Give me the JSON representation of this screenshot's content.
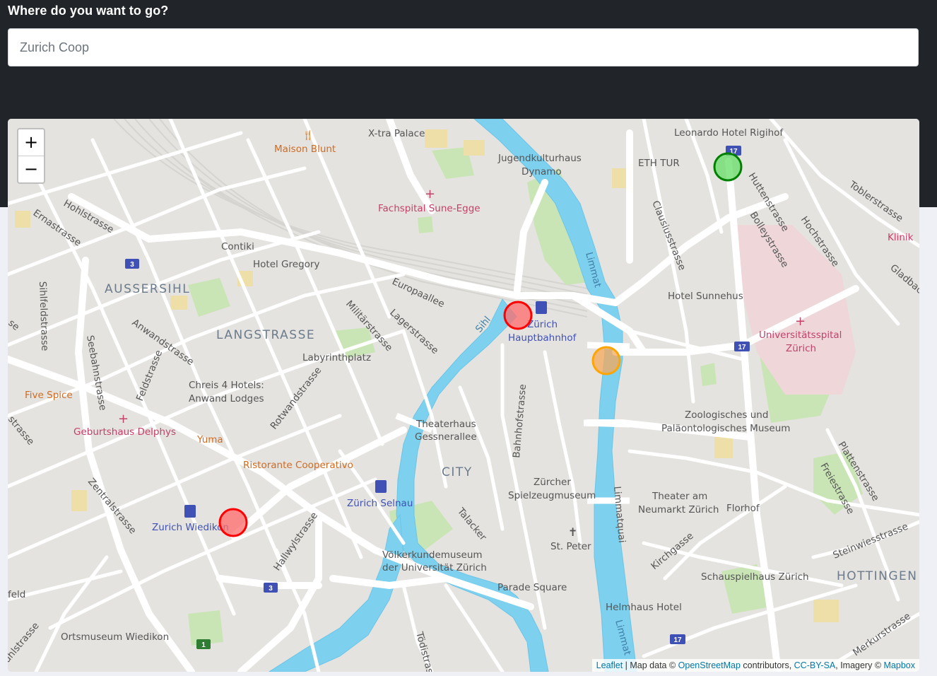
{
  "header": {
    "prompt": "Where do you want to go?",
    "search_value": "Zurich Coop"
  },
  "map": {
    "zoom_in": "+",
    "zoom_out": "−",
    "attribution": {
      "leaflet": "Leaflet",
      "sep1": " | Map data © ",
      "osm": "OpenStreetMap",
      "contrib": " contributors, ",
      "ccbysa": "CC-BY-SA",
      "imagery": ", Imagery © ",
      "mapbox": "Mapbox"
    },
    "labels": {
      "xtra": "X-tra Palace",
      "maison": "Maison Blunt",
      "jugend": "Jugendkulturhaus",
      "dynamo": "Dynamo",
      "leonardo": "Leonardo Hotel Rigihof",
      "eth": "ETH TUR",
      "fachspital": "Fachspital Sune-Egge",
      "hohl": "Hohlstrasse",
      "ernast": "Ernastrasse",
      "contiki": "Contiki",
      "gregory": "Hotel Gregory",
      "aussersihl": "AUSSERSIHL",
      "langstrasse": "LANGSTRASSE",
      "europa": "Europaallee",
      "militaer": "Militärstrasse",
      "lager": "Lagerstrasse",
      "limmat": "Limmat",
      "clausius": "Clausiusstrasse",
      "hutten": "Huttenstrasse",
      "bolley": "Bolleystrasse",
      "hoch": "Hochstrasse",
      "tobler": "Toblerstrasse",
      "klinik": "Klinik",
      "gladbach": "Gladbac",
      "sunnehus": "Hotel Sunnehus",
      "zuerich": "Zürich",
      "hbf": "Hauptbahnhof",
      "sihl": "Sihl",
      "uni1": "Universitätsspital",
      "uni2": "Zürich",
      "sihlfeld": "Sihlfeldstrasse",
      "anwand": "Anwandstrasse",
      "labyrinth": "Labyrinthplatz",
      "seebahn": "Seebahnstrasse",
      "chreis1": "Chreis 4 Hotels:",
      "chreis2": "Anwand Lodges",
      "feld": "Feldstrasse",
      "rotwand": "Rotwandstrasse",
      "five": "Five Spice",
      "geburt": "Geburtshaus Delphys",
      "yuma": "Yuma",
      "ristorante": "Ristorante Cooperativo",
      "theater1": "Theaterhaus",
      "theater2": "Gessnerallee",
      "city": "CITY",
      "bahnhof": "Bahnhofstrasse",
      "zoo1": "Zoologisches und",
      "zoo2": "Paläontologisches Museum",
      "platten": "Plattenstrasse",
      "frei": "Freiestrasse",
      "zentral": "Zentralstrasse",
      "wiedikon": "Zurich Wiedikon",
      "selnau": "Zürich Selnau",
      "spiel1": "Zürcher",
      "spiel2": "Spielzeugmuseum",
      "limmatquai": "Limmatquai",
      "neumarkt1": "Theater am",
      "neumarkt2": "Neumarkt Zürich",
      "florhof": "Florhof",
      "talacker": "Talacker",
      "hallwyl": "Hallwylstrasse",
      "voelker1": "Völkerkundemuseum",
      "voelker2": "der Universität Zürich",
      "peter": "St. Peter",
      "kirch": "Kirchgasse",
      "steinwies": "Steinwiesstrasse",
      "schauspiel": "Schauspielhaus Zürich",
      "hottingen": "HOTTINGEN",
      "parade": "Parade Square",
      "helmhaus": "Helmhaus Hotel",
      "ortsmuseum": "Ortsmuseum Wiedikon",
      "feld2": "feld",
      "toedi": "Tödistrasse",
      "merkur": "Merkurstrasse",
      "uhl": "uhlstrasse",
      "limmat2": "Limmat",
      "stras": "strasse",
      "se": "se",
      "route3a": "3",
      "route3b": "3",
      "route17a": "17",
      "route17b": "17",
      "route17c": "17",
      "route1": "1"
    },
    "markers": [
      {
        "name": "marker-hauptbahnhof",
        "color": "red",
        "fill": "#ff6b6b",
        "stroke": "#ff0000"
      },
      {
        "name": "marker-limmat",
        "color": "orange",
        "fill": "#f5a85a",
        "stroke": "#ffa500"
      },
      {
        "name": "marker-rigihof",
        "color": "green",
        "fill": "#66dd66",
        "stroke": "#008000"
      },
      {
        "name": "marker-wiedikon",
        "color": "red",
        "fill": "#ff6b6b",
        "stroke": "#ff0000"
      }
    ]
  }
}
